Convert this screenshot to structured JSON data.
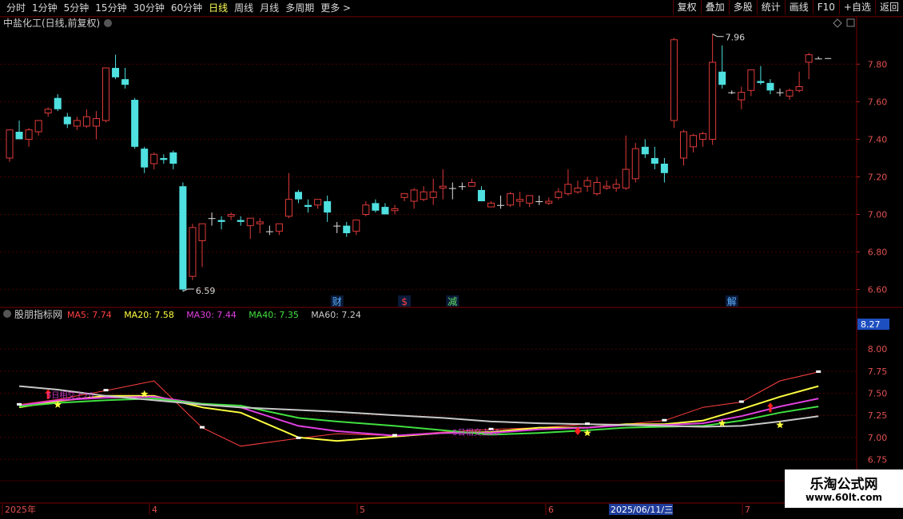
{
  "toolbar": {
    "periods": [
      "分时",
      "1分钟",
      "5分钟",
      "15分钟",
      "30分钟",
      "60分钟",
      "日线",
      "周线",
      "月线",
      "多周期",
      "更多 >"
    ],
    "active_period": "日线",
    "right_buttons": [
      "复权",
      "叠加",
      "多股",
      "统计",
      "画线",
      "F10",
      "+自选",
      "返回"
    ]
  },
  "main_chart": {
    "title": "中盐化工(日线,前复权)",
    "high_label": "7.96",
    "low_label": "6.59",
    "news_markers": [
      {
        "text": "财",
        "color": "#5ab0ff"
      },
      {
        "text": "$",
        "color": "#ff4040"
      },
      {
        "text": "减",
        "color": "#60e060"
      },
      {
        "text": "解",
        "color": "#5ab0ff"
      }
    ]
  },
  "indicator": {
    "name": "股朋指标网",
    "ma_labels": [
      {
        "name": "MA5",
        "value": "7.74",
        "color": "#ff4040"
      },
      {
        "name": "MA20",
        "value": "7.58",
        "color": "#ffff40"
      },
      {
        "name": "MA30",
        "value": "7.44",
        "color": "#e040e0"
      },
      {
        "name": "MA40",
        "value": "7.35",
        "color": "#40e040"
      },
      {
        "name": "MA60",
        "value": "7.24",
        "color": "#c8c8c8"
      }
    ],
    "current_value": "8.27",
    "annotation_1": "5日相交上20",
    "annotation_2": "5日相交上20"
  },
  "x_axis": {
    "labels": [
      "2025年",
      "4",
      "5",
      "6",
      "2025/06/11/三",
      "7"
    ]
  },
  "watermark": {
    "line1": "乐淘公式网",
    "line2": "www.60lt.com"
  },
  "chart_data": [
    {
      "type": "candlestick",
      "title": "中盐化工(日线,前复权)",
      "y_ticks": [
        "7.80",
        "7.60",
        "7.40",
        "7.20",
        "7.00",
        "6.80",
        "6.60"
      ],
      "ylim": [
        6.56,
        7.98
      ],
      "candles": [
        [
          7.3,
          7.45,
          7.28,
          7.45
        ],
        [
          7.44,
          7.5,
          7.4,
          7.4
        ],
        [
          7.4,
          7.46,
          7.36,
          7.45
        ],
        [
          7.44,
          7.5,
          7.42,
          7.5
        ],
        [
          7.54,
          7.57,
          7.52,
          7.56
        ],
        [
          7.62,
          7.64,
          7.55,
          7.56
        ],
        [
          7.52,
          7.54,
          7.46,
          7.48
        ],
        [
          7.47,
          7.52,
          7.45,
          7.5
        ],
        [
          7.47,
          7.56,
          7.46,
          7.52
        ],
        [
          7.47,
          7.55,
          7.4,
          7.51
        ],
        [
          7.5,
          7.78,
          7.49,
          7.78
        ],
        [
          7.78,
          7.85,
          7.72,
          7.73
        ],
        [
          7.72,
          7.78,
          7.67,
          7.69
        ],
        [
          7.61,
          7.62,
          7.35,
          7.36
        ],
        [
          7.35,
          7.36,
          7.22,
          7.25
        ],
        [
          7.27,
          7.33,
          7.24,
          7.32
        ],
        [
          7.3,
          7.32,
          7.27,
          7.29
        ],
        [
          7.33,
          7.34,
          7.24,
          7.27
        ],
        [
          7.15,
          7.17,
          6.59,
          6.6
        ],
        [
          6.67,
          6.95,
          6.65,
          6.93
        ],
        [
          6.86,
          6.95,
          6.72,
          6.95
        ],
        [
          6.98,
          7.01,
          6.94,
          6.98
        ],
        [
          6.97,
          6.99,
          6.92,
          6.96
        ],
        [
          6.99,
          7.01,
          6.97,
          7.0
        ],
        [
          6.97,
          6.99,
          6.94,
          6.96
        ],
        [
          6.94,
          6.98,
          6.87,
          6.98
        ],
        [
          6.95,
          6.98,
          6.9,
          6.96
        ],
        [
          6.91,
          6.94,
          6.89,
          6.91
        ],
        [
          6.91,
          6.95,
          6.89,
          6.95
        ],
        [
          6.99,
          7.22,
          6.98,
          7.08
        ],
        [
          7.12,
          7.13,
          7.06,
          7.08
        ],
        [
          7.05,
          7.08,
          7.01,
          7.04
        ],
        [
          7.05,
          7.08,
          7.03,
          7.08
        ],
        [
          7.07,
          7.1,
          6.96,
          7.01
        ],
        [
          6.94,
          6.96,
          6.9,
          6.94
        ],
        [
          6.94,
          6.96,
          6.88,
          6.9
        ],
        [
          6.91,
          6.97,
          6.89,
          6.97
        ],
        [
          7.0,
          7.07,
          6.99,
          7.05
        ],
        [
          7.06,
          7.08,
          7.01,
          7.02
        ],
        [
          7.04,
          7.06,
          7.0,
          7.0
        ],
        [
          7.02,
          7.05,
          7.0,
          7.03
        ],
        [
          7.09,
          7.11,
          7.07,
          7.11
        ],
        [
          7.07,
          7.14,
          7.03,
          7.13
        ],
        [
          7.08,
          7.15,
          7.07,
          7.12
        ],
        [
          7.09,
          7.19,
          7.05,
          7.12
        ],
        [
          7.14,
          7.24,
          7.08,
          7.15
        ],
        [
          7.14,
          7.17,
          7.08,
          7.14
        ],
        [
          7.15,
          7.17,
          7.13,
          7.15
        ],
        [
          7.15,
          7.19,
          7.15,
          7.17
        ],
        [
          7.13,
          7.15,
          7.07,
          7.07
        ],
        [
          7.04,
          7.07,
          7.04,
          7.06
        ],
        [
          7.05,
          7.1,
          7.03,
          7.05
        ],
        [
          7.05,
          7.12,
          7.04,
          7.11
        ],
        [
          7.07,
          7.12,
          7.04,
          7.08
        ],
        [
          7.06,
          7.1,
          7.04,
          7.1
        ],
        [
          7.07,
          7.1,
          7.05,
          7.07
        ],
        [
          7.06,
          7.09,
          7.05,
          7.07
        ],
        [
          7.09,
          7.14,
          7.08,
          7.12
        ],
        [
          7.11,
          7.24,
          7.1,
          7.16
        ],
        [
          7.12,
          7.18,
          7.11,
          7.14
        ],
        [
          7.15,
          7.2,
          7.12,
          7.18
        ],
        [
          7.11,
          7.2,
          7.1,
          7.17
        ],
        [
          7.14,
          7.18,
          7.13,
          7.15
        ],
        [
          7.14,
          7.19,
          7.12,
          7.16
        ],
        [
          7.14,
          7.42,
          7.13,
          7.24
        ],
        [
          7.19,
          7.38,
          7.17,
          7.35
        ],
        [
          7.36,
          7.4,
          7.3,
          7.32
        ],
        [
          7.3,
          7.36,
          7.24,
          7.27
        ],
        [
          7.27,
          7.3,
          7.17,
          7.22
        ],
        [
          7.5,
          7.94,
          7.46,
          7.93
        ],
        [
          7.3,
          7.45,
          7.26,
          7.44
        ],
        [
          7.36,
          7.43,
          7.33,
          7.42
        ],
        [
          7.4,
          7.44,
          7.36,
          7.43
        ],
        [
          7.4,
          7.96,
          7.37,
          7.81
        ],
        [
          7.76,
          7.9,
          7.67,
          7.69
        ],
        [
          7.65,
          7.66,
          7.64,
          7.65
        ],
        [
          7.61,
          7.68,
          7.56,
          7.65
        ],
        [
          7.66,
          7.77,
          7.63,
          7.77
        ],
        [
          7.71,
          7.79,
          7.69,
          7.7
        ],
        [
          7.7,
          7.72,
          7.64,
          7.66
        ],
        [
          7.65,
          7.67,
          7.63,
          7.65
        ],
        [
          7.63,
          7.67,
          7.61,
          7.66
        ],
        [
          7.66,
          7.76,
          7.65,
          7.68
        ],
        [
          7.81,
          7.86,
          7.72,
          7.85
        ],
        [
          7.83,
          7.84,
          7.83,
          7.83
        ]
      ]
    },
    {
      "type": "line",
      "title": "股朋指标网",
      "y_ticks": [
        "8.27",
        "8.00",
        "7.75",
        "7.50",
        "7.25",
        "7.00",
        "6.75"
      ],
      "ylim": [
        6.6,
        8.3
      ],
      "x": [
        1,
        5,
        10,
        15,
        20,
        24,
        30,
        34,
        40,
        45,
        50,
        55,
        60,
        64,
        68,
        72,
        76,
        80,
        84
      ],
      "series": [
        {
          "name": "MA5",
          "color": "#ff4040",
          "values": [
            7.37,
            7.43,
            7.53,
            7.64,
            7.11,
            6.9,
            6.99,
            7.04,
            7.02,
            7.06,
            7.09,
            7.11,
            7.15,
            7.15,
            7.19,
            7.34,
            7.4,
            7.64,
            7.74
          ]
        },
        {
          "name": "MA20",
          "color": "#ffff40",
          "values": [
            7.34,
            7.41,
            7.47,
            7.47,
            7.34,
            7.28,
            7.0,
            6.96,
            7.01,
            7.05,
            7.06,
            7.11,
            7.11,
            7.15,
            7.15,
            7.19,
            7.32,
            7.46,
            7.58
          ]
        },
        {
          "name": "MA30",
          "color": "#e040e0",
          "values": [
            7.36,
            7.42,
            7.45,
            7.46,
            7.38,
            7.34,
            7.13,
            7.07,
            7.02,
            7.05,
            7.05,
            7.09,
            7.11,
            7.14,
            7.14,
            7.16,
            7.24,
            7.35,
            7.44
          ]
        },
        {
          "name": "MA40",
          "color": "#40e040",
          "values": [
            7.35,
            7.39,
            7.42,
            7.44,
            7.38,
            7.36,
            7.22,
            7.18,
            7.13,
            7.08,
            7.03,
            7.05,
            7.08,
            7.11,
            7.12,
            7.13,
            7.19,
            7.28,
            7.35
          ]
        },
        {
          "name": "MA60",
          "color": "#c8c8c8",
          "values": [
            7.58,
            7.54,
            7.47,
            7.42,
            7.37,
            7.34,
            7.31,
            7.29,
            7.25,
            7.22,
            7.18,
            7.16,
            7.15,
            7.14,
            7.13,
            7.12,
            7.13,
            7.18,
            7.24
          ]
        }
      ],
      "star_markers": [
        [
          5,
          7.37
        ],
        [
          14,
          7.49
        ],
        [
          60,
          7.05
        ],
        [
          74,
          7.16
        ],
        [
          80,
          7.14
        ]
      ],
      "diamond_markers": [
        [
          59,
          7.07
        ]
      ],
      "arrow_markers": [
        [
          4,
          7.48
        ],
        [
          79,
          7.33
        ]
      ]
    }
  ]
}
